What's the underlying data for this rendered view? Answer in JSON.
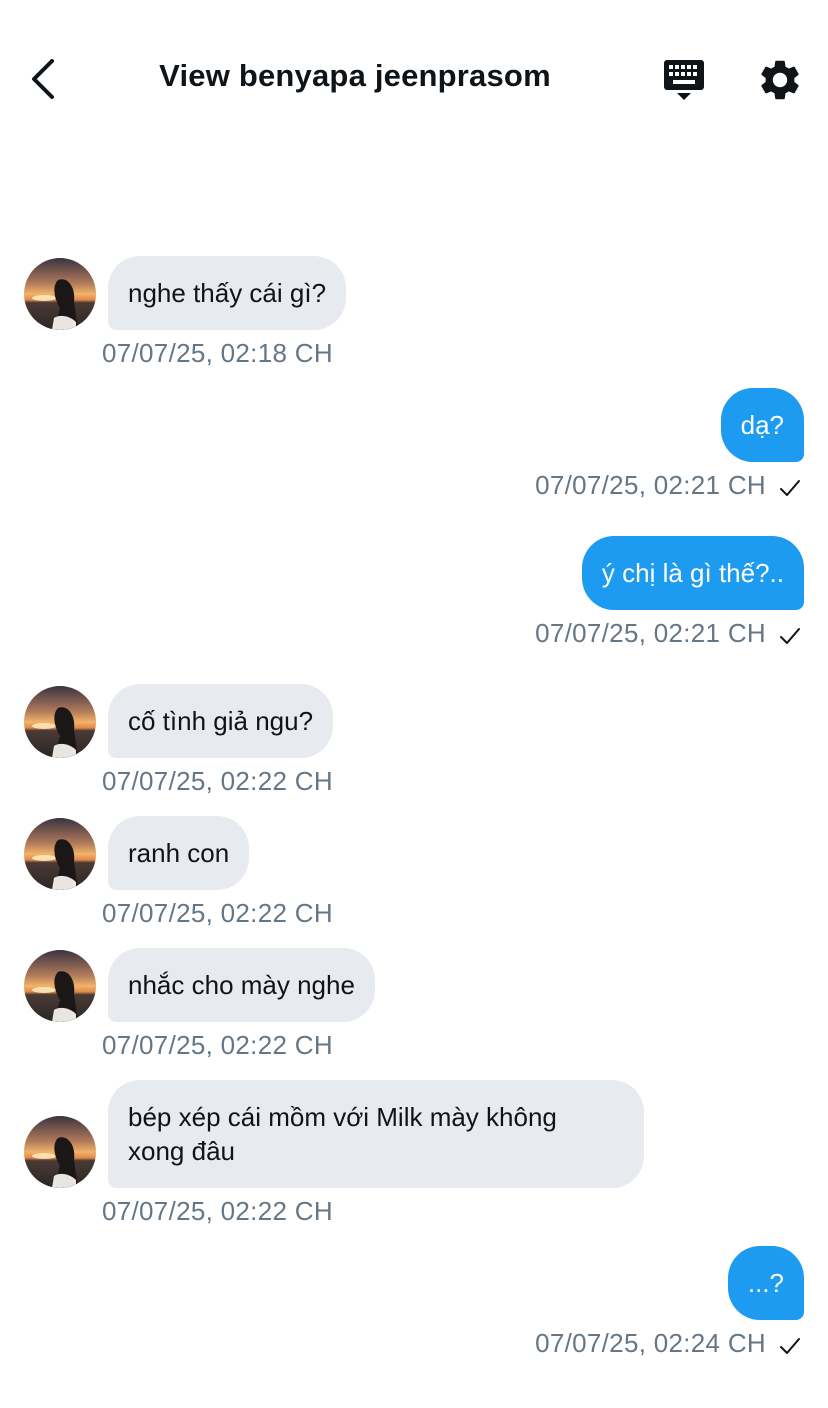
{
  "header": {
    "title": "View benyapa jeenprasom",
    "back_icon": "chevron-left-icon",
    "keyboard_icon": "keyboard-icon",
    "settings_icon": "gear-icon"
  },
  "messages": [
    {
      "direction": "in",
      "text": "nghe thấy cái gì?",
      "time": "07/07/25, 02:18 CH"
    },
    {
      "direction": "out",
      "text": "dạ?",
      "time": "07/07/25, 02:21 CH",
      "status_icon": "check-icon"
    },
    {
      "direction": "out",
      "text": "ý chị là gì thế?..",
      "time": "07/07/25, 02:21 CH",
      "status_icon": "check-icon"
    },
    {
      "direction": "in",
      "text": "cố tình giả ngu?",
      "time": "07/07/25, 02:22 CH"
    },
    {
      "direction": "in",
      "text": "ranh con",
      "time": "07/07/25, 02:22 CH"
    },
    {
      "direction": "in",
      "text": "nhắc cho mày nghe",
      "time": "07/07/25, 02:22 CH"
    },
    {
      "direction": "in",
      "text": "bép xép cái mồm với Milk mày không\nxong đâu",
      "time": "07/07/25, 02:22 CH"
    },
    {
      "direction": "out",
      "text": "...?",
      "time": "07/07/25, 02:24 CH",
      "status_icon": "check-icon"
    }
  ],
  "colors": {
    "outgoing_bubble": "#1d9bf0",
    "incoming_bubble": "#e7ebef",
    "timestamp": "#657786"
  }
}
